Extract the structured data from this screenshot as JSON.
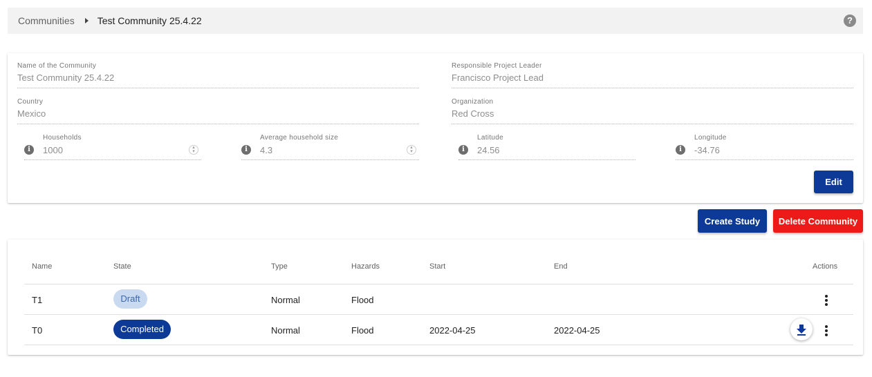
{
  "breadcrumb": {
    "root": "Communities",
    "current": "Test Community 25.4.22"
  },
  "help": {
    "glyph": "?"
  },
  "community": {
    "name_label": "Name of the Community",
    "name_value": "Test Community 25.4.22",
    "leader_label": "Responsible Project Leader",
    "leader_value": "Francisco Project Lead",
    "country_label": "Country",
    "country_value": "Mexico",
    "org_label": "Organization",
    "org_value": "Red Cross",
    "households_label": "Households",
    "households_value": "1000",
    "avg_label": "Average household size",
    "avg_value": "4.3",
    "lat_label": "Latitude",
    "lat_value": "24.56",
    "lon_label": "Longitude",
    "lon_value": "-34.76",
    "info_glyph": "i"
  },
  "buttons": {
    "edit": "Edit",
    "create_study": "Create Study",
    "delete_community": "Delete Community"
  },
  "table": {
    "headers": {
      "name": "Name",
      "state": "State",
      "type": "Type",
      "hazards": "Hazards",
      "start": "Start",
      "end": "End",
      "actions": "Actions"
    },
    "rows": [
      {
        "name": "T1",
        "state": "Draft",
        "type": "Normal",
        "hazards": "Flood",
        "start": "",
        "end": ""
      },
      {
        "name": "T0",
        "state": "Completed",
        "type": "Normal",
        "hazards": "Flood",
        "start": "2022-04-25",
        "end": "2022-04-25"
      }
    ]
  },
  "colors": {
    "primary": "#0c3a96",
    "danger": "#ee1a1a",
    "draft_chip": "#c9daf0"
  },
  "icons": {
    "help": "help-circle-icon",
    "info": "info-icon",
    "download": "download-icon",
    "more": "more-vert-icon"
  }
}
